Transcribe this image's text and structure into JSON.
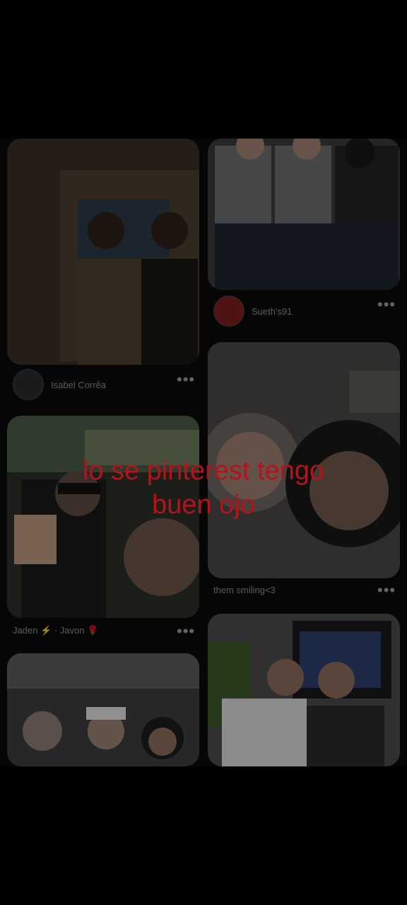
{
  "pins": [
    {
      "id": "pin1",
      "caption": "Isabel Corrêa",
      "more": "•••",
      "bg": "#3a2f25"
    },
    {
      "id": "pin2",
      "caption": "Sueth's91",
      "more": "•••",
      "bg": "#3c3a38"
    },
    {
      "id": "pin3",
      "caption": "Jaden ⚡ · Javon 🌹",
      "more": "•••",
      "bg": "#2c2f29"
    },
    {
      "id": "pin4",
      "caption": "them smiling<3",
      "more": "•••",
      "bg": "#2a2826"
    },
    {
      "id": "pin5",
      "caption": "",
      "more": "",
      "bg": "#2d2d2f"
    },
    {
      "id": "pin6",
      "caption": "",
      "more": "",
      "bg": "#2a2a2a"
    }
  ],
  "overlay": {
    "line1": "lo se pinterest tengo",
    "line2": "buen ojo",
    "color": "#b3141b"
  }
}
